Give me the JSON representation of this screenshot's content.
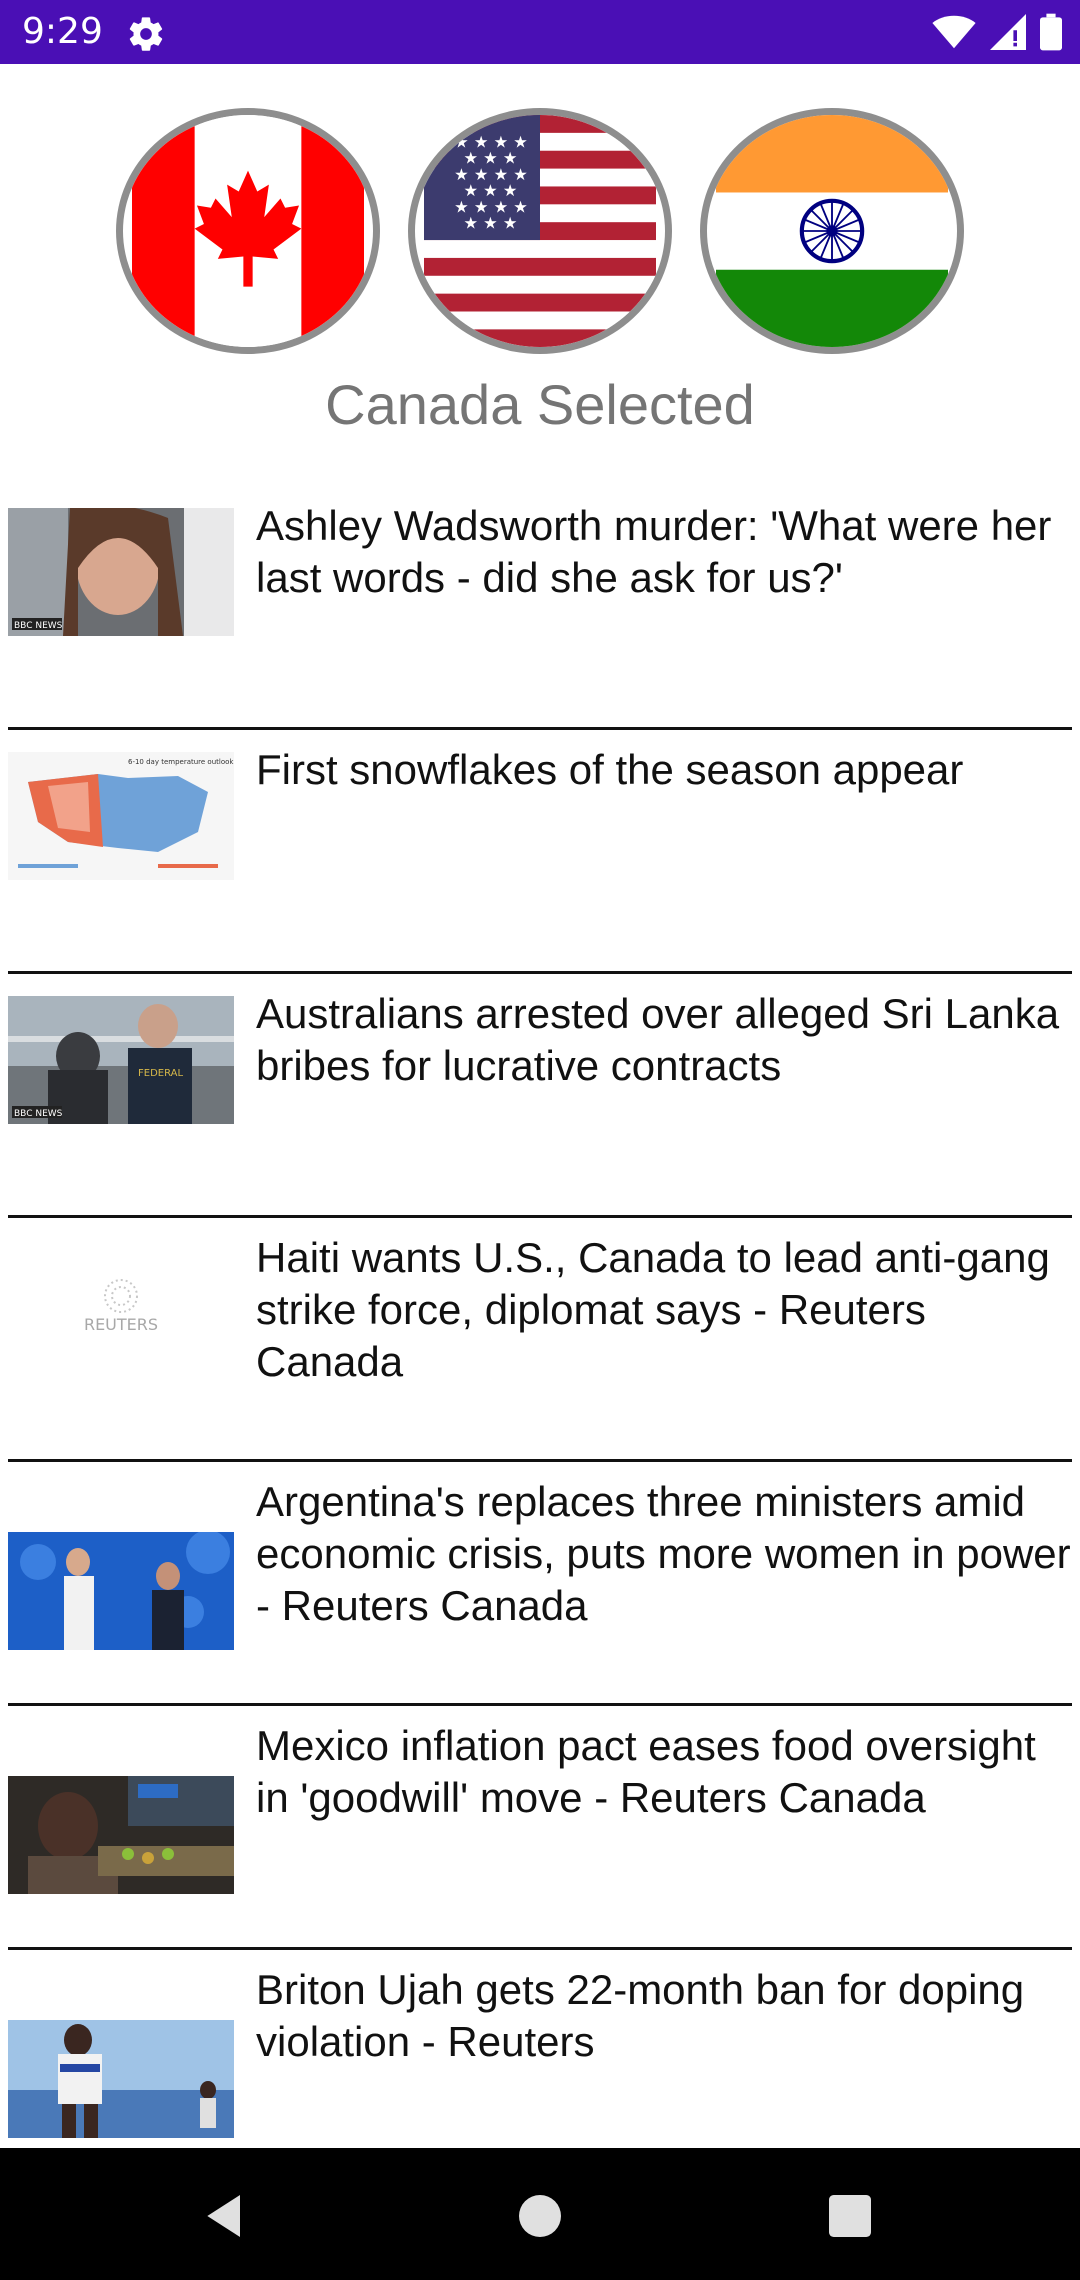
{
  "status_bar": {
    "time": "9:29",
    "icons": [
      "settings-icon",
      "wifi-icon",
      "signal-icon",
      "battery-icon"
    ],
    "background": "#4a0fb5"
  },
  "flags": [
    {
      "country": "Canada",
      "icon": "canada-flag-icon"
    },
    {
      "country": "USA",
      "icon": "usa-flag-icon"
    },
    {
      "country": "India",
      "icon": "india-flag-icon"
    }
  ],
  "selection_label": "Canada Selected",
  "news": [
    {
      "headline": "Ashley Wadsworth murder: 'What were her last words - did she ask for us?'",
      "thumb_badge": "BBC NEWS"
    },
    {
      "headline": "First snowflakes of the season appear",
      "thumb_badge": "6-10 day temperature outlook"
    },
    {
      "headline": "Australians arrested over alleged Sri Lanka bribes for lucrative contracts",
      "thumb_badge": "BBC NEWS"
    },
    {
      "headline": "Haiti wants U.S., Canada to lead anti-gang strike force, diplomat says - Reuters Canada",
      "thumb_badge": "REUTERS"
    },
    {
      "headline": "Argentina's replaces three ministers amid economic crisis, puts more women in power - Reuters Canada",
      "thumb_badge": ""
    },
    {
      "headline": "Mexico inflation pact eases food oversight in 'goodwill' move - Reuters Canada",
      "thumb_badge": ""
    },
    {
      "headline": "Briton Ujah gets 22-month ban for doping violation - Reuters",
      "thumb_badge": ""
    }
  ],
  "nav_bar": {
    "icons": [
      "back-icon",
      "home-icon",
      "recents-icon"
    ]
  }
}
